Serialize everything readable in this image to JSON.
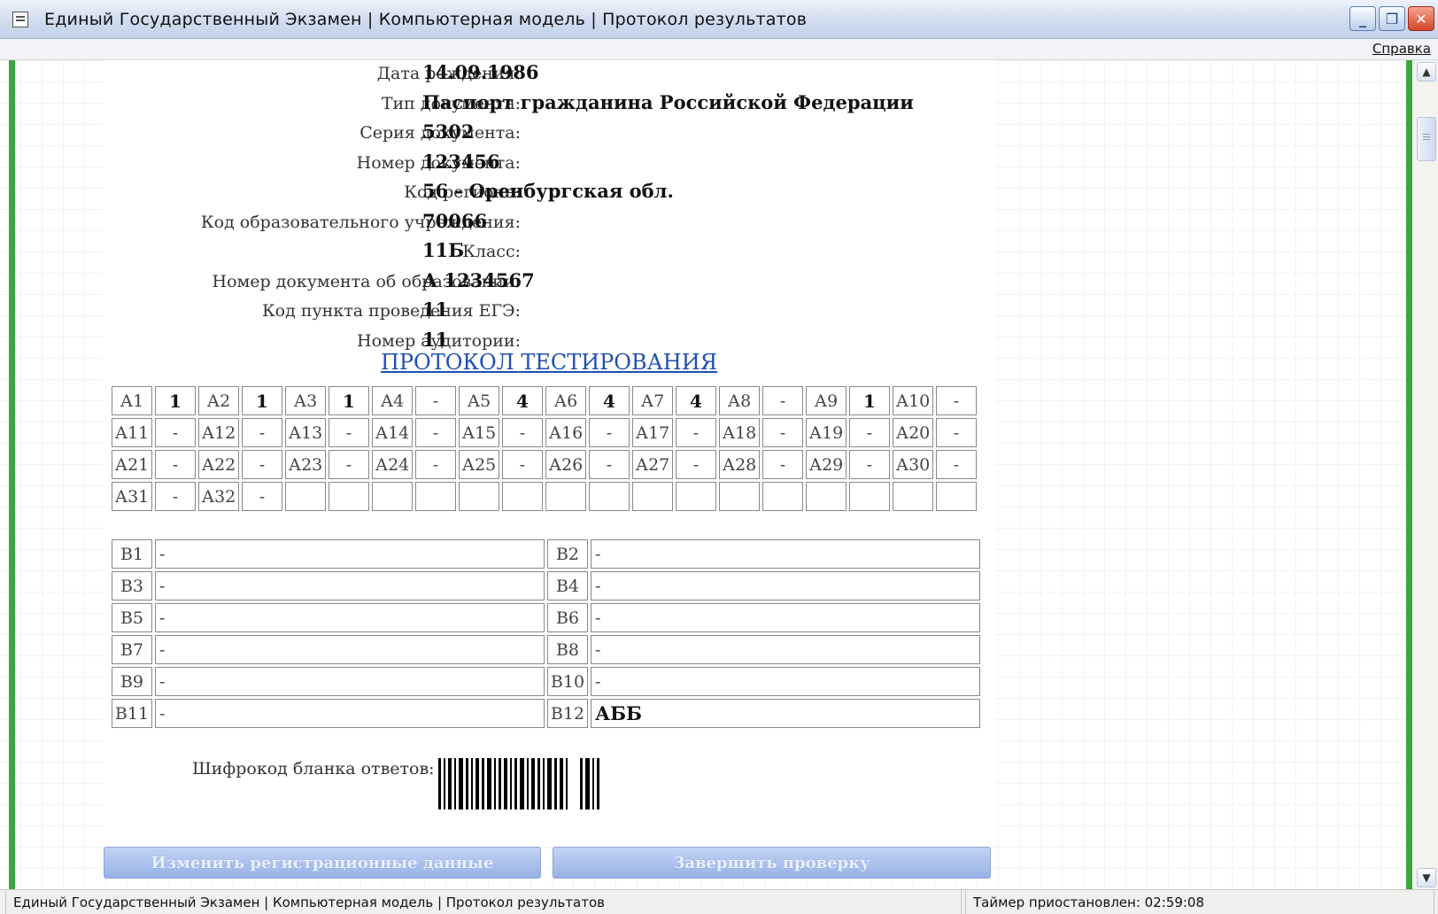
{
  "window": {
    "title": "Единый Государственный Экзамен | Компьютерная модель | Протокол результатов",
    "min_icon": "minimize-icon",
    "restore_icon": "restore-icon",
    "close_icon": "close-icon"
  },
  "menu": {
    "help": "Справка"
  },
  "info": [
    {
      "label": "Дата рождения:",
      "value": "14.09.1986"
    },
    {
      "label": "Тип документа:",
      "value": "Паспорт гражданина Российской Федерации"
    },
    {
      "label": "Серия документа:",
      "value": "5302"
    },
    {
      "label": "Номер документа:",
      "value": "123456"
    },
    {
      "label": "Код региона:",
      "value": "56 - Оренбургская обл."
    },
    {
      "label": "Код образовательного учреждения:",
      "value": "70066"
    },
    {
      "label": "Класс:",
      "value": "11Б"
    },
    {
      "label": "Номер документа об образовании:",
      "value": "А 1234567"
    },
    {
      "label": "Код пункта проведения ЕГЭ:",
      "value": "11"
    },
    {
      "label": "Номер аудитории:",
      "value": "11"
    }
  ],
  "protocol": {
    "title": "ПРОТОКОЛ ТЕСТИРОВАНИЯ",
    "a_rows": [
      [
        [
          "А1",
          "1"
        ],
        [
          "А2",
          "1"
        ],
        [
          "А3",
          "1"
        ],
        [
          "А4",
          "-"
        ],
        [
          "А5",
          "4"
        ],
        [
          "А6",
          "4"
        ],
        [
          "А7",
          "4"
        ],
        [
          "А8",
          "-"
        ],
        [
          "А9",
          "1"
        ],
        [
          "А10",
          "-"
        ]
      ],
      [
        [
          "А11",
          "-"
        ],
        [
          "А12",
          "-"
        ],
        [
          "А13",
          "-"
        ],
        [
          "А14",
          "-"
        ],
        [
          "А15",
          "-"
        ],
        [
          "А16",
          "-"
        ],
        [
          "А17",
          "-"
        ],
        [
          "А18",
          "-"
        ],
        [
          "А19",
          "-"
        ],
        [
          "А20",
          "-"
        ]
      ],
      [
        [
          "А21",
          "-"
        ],
        [
          "А22",
          "-"
        ],
        [
          "А23",
          "-"
        ],
        [
          "А24",
          "-"
        ],
        [
          "А25",
          "-"
        ],
        [
          "А26",
          "-"
        ],
        [
          "А27",
          "-"
        ],
        [
          "А28",
          "-"
        ],
        [
          "А29",
          "-"
        ],
        [
          "А30",
          "-"
        ]
      ],
      [
        [
          "А31",
          "-"
        ],
        [
          "А32",
          "-"
        ],
        [
          "",
          ""
        ],
        [
          "",
          ""
        ],
        [
          "",
          ""
        ],
        [
          "",
          ""
        ],
        [
          "",
          ""
        ],
        [
          "",
          ""
        ],
        [
          "",
          ""
        ],
        [
          "",
          ""
        ]
      ]
    ],
    "b_rows": [
      [
        [
          "В1",
          "-"
        ],
        [
          "В2",
          "-"
        ]
      ],
      [
        [
          "В3",
          "-"
        ],
        [
          "В4",
          "-"
        ]
      ],
      [
        [
          "В5",
          "-"
        ],
        [
          "В6",
          "-"
        ]
      ],
      [
        [
          "В7",
          "-"
        ],
        [
          "В8",
          "-"
        ]
      ],
      [
        [
          "В9",
          "-"
        ],
        [
          "В10",
          "-"
        ]
      ],
      [
        [
          "В11",
          "-"
        ],
        [
          "В12",
          "АББ"
        ]
      ]
    ],
    "cipher_label": "Шифрокод бланка ответов:"
  },
  "buttons": {
    "edit": "Изменить регистрационные данные",
    "finish": "Завершить проверку"
  },
  "status": {
    "left": "Единый Государственный Экзамен | Компьютерная модель | Протокол результатов",
    "right": "Таймер приостановлен: 02:59:08"
  }
}
